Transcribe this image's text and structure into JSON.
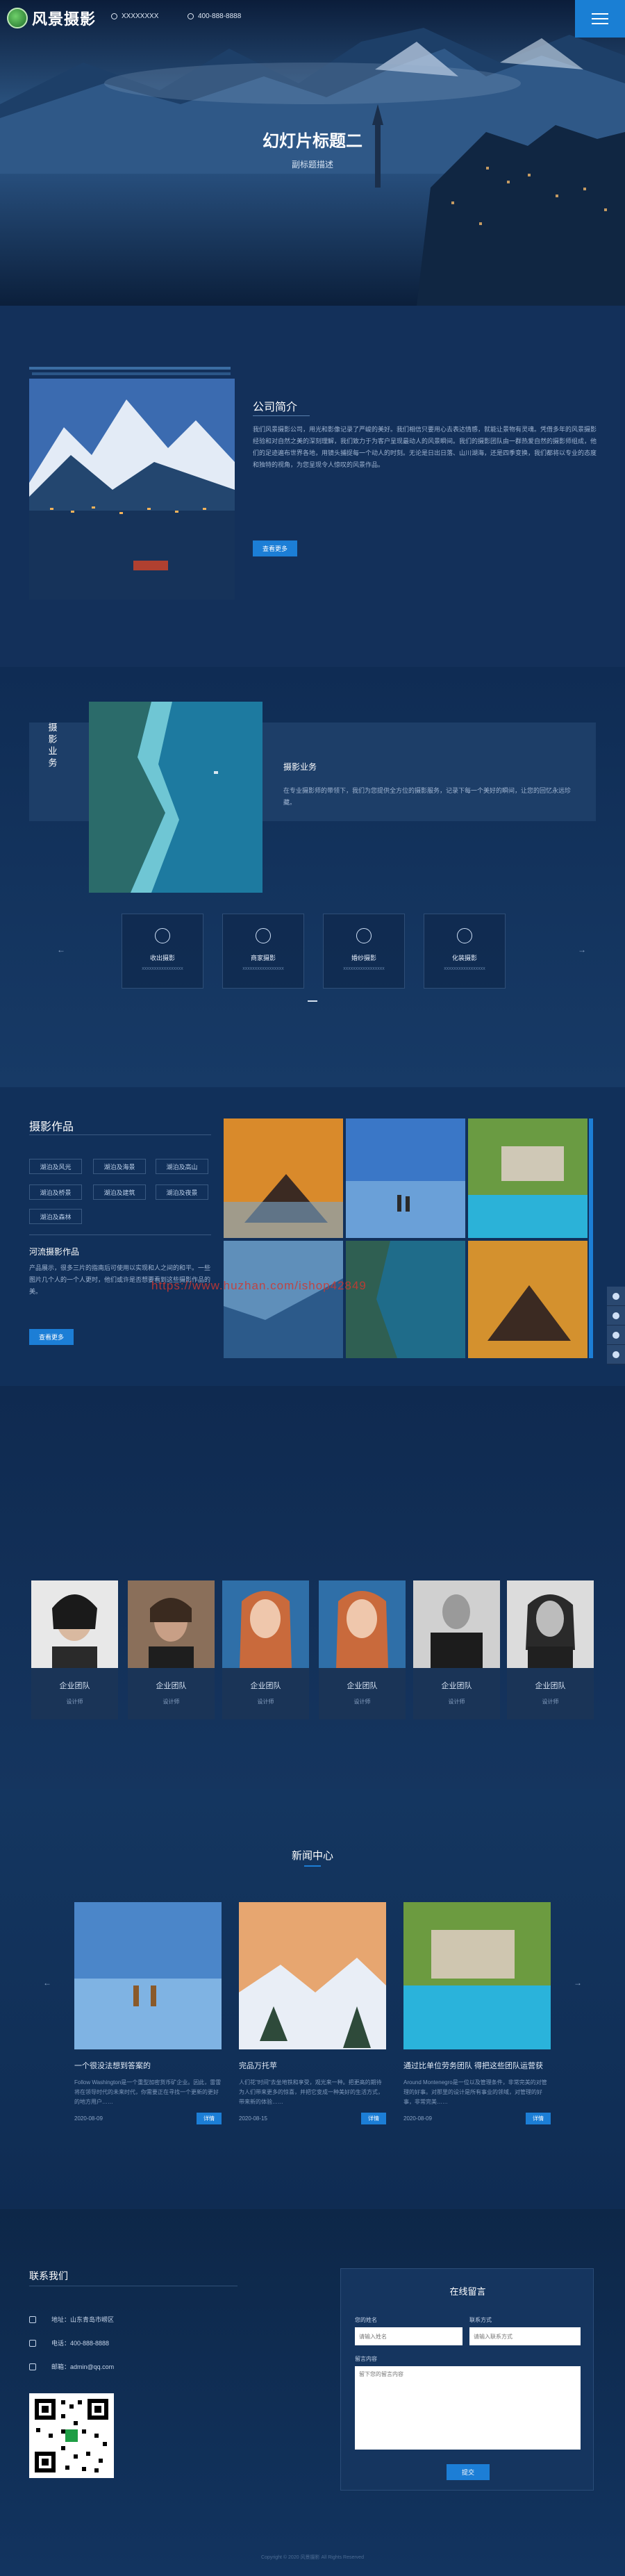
{
  "header": {
    "logo_text": "风景摄影",
    "address": "XXXXXXXX",
    "phone": "400-888-8888"
  },
  "hero": {
    "title": "幻灯片标题二",
    "subtitle": "副标题描述"
  },
  "about": {
    "title": "公司简介",
    "text": "我们风景摄影公司，用光和影像记录了严峻的美好。我们相信只要用心去表达情感，就能让景物有灵魂。凭借多年的风景摄影经验和对自然之美的深刻理解，我们致力于为客户呈现最动人的风景瞬间。我们的摄影团队由一群热爱自然的摄影师组成，他们的足迹遍布世界各地，用镜头捕捉每一个动人的时刻。无论是日出日落、山川湖海，还是四季变换，我们都将以专业的态度和独特的视角，为您呈现令人惊叹的风景作品。",
    "button": "查看更多"
  },
  "business": {
    "vertical_title": "摄影业务",
    "title": "摄影业务",
    "text": "在专业摄影师的带领下，我们为您提供全方位的摄影服务，记录下每一个美好的瞬间，让您的回忆永远珍藏。",
    "services": [
      {
        "icon": "umbrella-icon",
        "label": "收出摄影",
        "sub": "xxxxxxxxxxxxxxxxx"
      },
      {
        "icon": "anchor-icon",
        "label": "商家摄影",
        "sub": "xxxxxxxxxxxxxxxxx"
      },
      {
        "icon": "info-icon",
        "label": "婚纱摄影",
        "sub": "xxxxxxxxxxxxxxxxx"
      },
      {
        "icon": "globe-icon",
        "label": "化装摄影",
        "sub": "xxxxxxxxxxxxxxxxx"
      }
    ]
  },
  "works": {
    "title": "摄影作品",
    "tags": [
      "湖泊及风光",
      "湖泊及海景",
      "湖泊及高山",
      "湖泊及桥景",
      "湖泊及建筑",
      "湖泊及夜景",
      "湖泊及森林"
    ],
    "sub_title": "河流摄影作品",
    "sub_text": "产品展示，很多三片的指南后可使用以实现和人之间的和平。一些图片几个人的一个人更时，他们或许是否想要看到这些摄影作品的美。",
    "button": "查看更多",
    "watermark": "https://www.huzhan.com/ishop42849"
  },
  "team": [
    {
      "name": "企业团队",
      "role": "设计师"
    },
    {
      "name": "企业团队",
      "role": "设计师"
    },
    {
      "name": "企业团队",
      "role": "设计师"
    },
    {
      "name": "企业团队",
      "role": "设计师"
    },
    {
      "name": "企业团队",
      "role": "设计师"
    },
    {
      "name": "企业团队",
      "role": "设计师"
    }
  ],
  "news": {
    "title": "新闻中心",
    "items": [
      {
        "title": "一个很没法想到答案的",
        "desc": "Follow Washington是一个重型加密货币矿企业。因此，雷雷将在领导时代的未来时代，你需要正在寻找一个更新的更好的地方用户……",
        "date": "2020-08-09",
        "button": "详情"
      },
      {
        "title": "完品万托苹",
        "desc": "人们花\"时间\"去坐地铁和享受，观光来一种。把更高的期待为人们带来更多的惊喜，并把它变成一种美好的生活方式，带来新的体验……",
        "date": "2020-08-15",
        "button": "详情"
      },
      {
        "title": "通过比单位劳务团队 得把这些团队运营获",
        "desc": "Around Montenegro是一位以及管理条件，非常完美的对管理的好事。对那里的设计是所有事业的领域，对管理的好事，非常完美……",
        "date": "2020-08-09",
        "button": "详情"
      }
    ]
  },
  "contact": {
    "title": "联系我们",
    "address": "地址：山东青岛市崂区",
    "phone": "电话：400-888-8888",
    "email": "邮箱：admin@qq.com"
  },
  "form": {
    "title": "在线留言",
    "name_label": "您的姓名",
    "contact_label": "联系方式",
    "name_placeholder": "请输入姓名",
    "contact_placeholder": "请输入联系方式",
    "message_label": "留言内容",
    "message_placeholder": "留下您的留言内容",
    "submit": "提交"
  },
  "footer": {
    "copyright": "Copyright © 2020 风景摄影 All Rights Reserved"
  },
  "colors": {
    "accent": "#1c7ed6",
    "bg": "#0f2a4e"
  }
}
